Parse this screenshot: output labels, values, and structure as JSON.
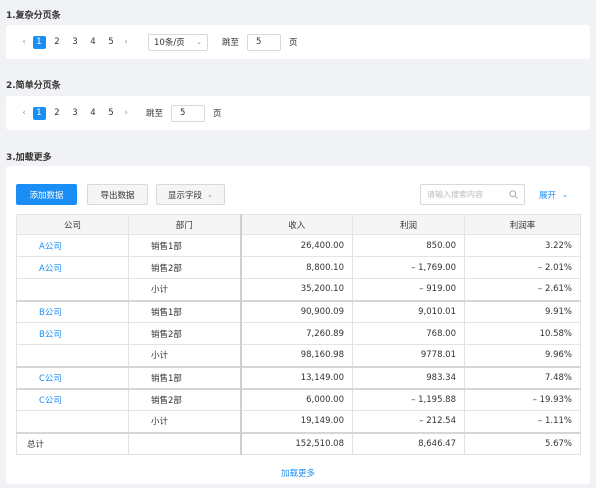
{
  "sections": {
    "complex_title": "1.复杂分页条",
    "simple_title": "2.简单分页条",
    "loadmore_title": "3.加载更多"
  },
  "pager_complex": {
    "prev": "‹",
    "next": "›",
    "pages": [
      "1",
      "2",
      "3",
      "4",
      "5"
    ],
    "active_page": "1",
    "page_size": "10条/页",
    "jump_label": "跳至",
    "jump_value": "5",
    "jump_suffix": "页"
  },
  "pager_simple": {
    "prev": "‹",
    "next": "›",
    "pages": [
      "1",
      "2",
      "3",
      "4",
      "5"
    ],
    "active_page": "1",
    "jump_label": "跳至",
    "jump_value": "5",
    "jump_suffix": "页"
  },
  "toolbar": {
    "add_label": "添加数据",
    "export_label": "导出数据",
    "fields_label": "显示字段",
    "search_placeholder": "请输入搜索内容",
    "expand_label": "展开"
  },
  "table": {
    "columns": [
      "公司",
      "部门",
      "收入",
      "利润",
      "利润率"
    ],
    "rows": [
      {
        "company": "A公司",
        "dept": "销售1部",
        "income": "26,400.00",
        "profit": "850.00",
        "rate": "3.22%"
      },
      {
        "company": "A公司",
        "dept": "销售2部",
        "income": "8,800.10",
        "profit": "– 1,769.00",
        "rate": "– 2.01%"
      },
      {
        "company": "",
        "dept": "小计",
        "income": "35,200.10",
        "profit": "– 919.00",
        "rate": "– 2.61%"
      },
      {
        "company": "B公司",
        "dept": "销售1部",
        "income": "90,900.09",
        "profit": "9,010.01",
        "rate": "9.91%"
      },
      {
        "company": "B公司",
        "dept": "销售2部",
        "income": "7,260.89",
        "profit": "768.00",
        "rate": "10.58%"
      },
      {
        "company": "",
        "dept": "小计",
        "income": "98,160.98",
        "profit": "9778.01",
        "rate": "9.96%"
      },
      {
        "company": "C公司",
        "dept": "销售1部",
        "income": "13,149.00",
        "profit": "983.34",
        "rate": "7.48%"
      },
      {
        "company": "C公司",
        "dept": "销售2部",
        "income": "6,000.00",
        "profit": "– 1,195.88",
        "rate": "– 19.93%"
      },
      {
        "company": "",
        "dept": "小计",
        "income": "19,149.00",
        "profit": "– 212.54",
        "rate": "– 1.11%"
      },
      {
        "company": "总计",
        "dept": "",
        "income": "152,510.08",
        "profit": "8,646.47",
        "rate": "5.67%"
      }
    ]
  },
  "loadmore_label": "加载更多",
  "colors": {
    "accent": "#1a8ef5",
    "background": "#f0f2f5"
  }
}
